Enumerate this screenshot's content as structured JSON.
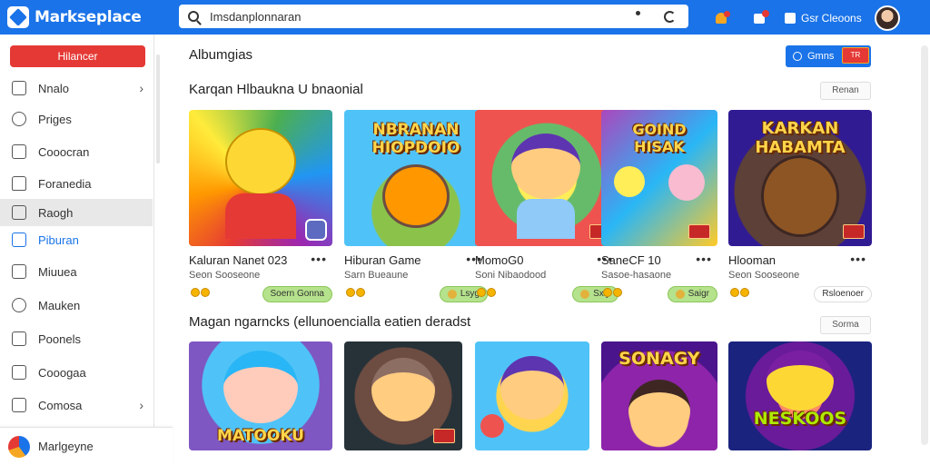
{
  "app": {
    "name": "Markseplace"
  },
  "search": {
    "value": "Imsdanplonnaran"
  },
  "user": {
    "label": "Gsr Cleoons"
  },
  "sidebar": {
    "top_button": "Hilancer",
    "items": [
      {
        "label": "Nnalo",
        "icon": "sparkle-icon",
        "chevron": "›"
      },
      {
        "label": "Priges",
        "icon": "drop-icon"
      },
      {
        "label": "Cooocran",
        "icon": "chat-icon"
      },
      {
        "label": "Foranedia",
        "icon": "home-icon"
      },
      {
        "label": "Raogh",
        "icon": "folder-icon",
        "selected": true
      },
      {
        "label": "Piburan",
        "icon": "window-icon",
        "active": true
      },
      {
        "label": "Miuuea",
        "icon": "pen-icon"
      },
      {
        "label": "Mauken",
        "icon": "target-icon"
      },
      {
        "label": "Poonels",
        "icon": "puzzle-icon"
      },
      {
        "label": "Cooogaa",
        "icon": "doc-icon"
      },
      {
        "label": "Comosa",
        "icon": "list-icon",
        "chevron": "›"
      }
    ],
    "footer": "Marlgeyne"
  },
  "main": {
    "title": "Albumgias",
    "header_button": {
      "label": "Gmns",
      "badge": "TR"
    },
    "sections": [
      {
        "title": "Karqan Hlbaukna U bnaonial",
        "more": "Renan",
        "cards": [
          {
            "title": "Kaluran Nanet 023",
            "sub": "Seon Sooseone",
            "tag": "Soern Gonna"
          },
          {
            "title": "Hiburan Game",
            "sub": "Sarn Bueaune",
            "tag": "Lsyg"
          },
          {
            "title": "MomoG0",
            "sub": "Soni Nibaodood",
            "tag": "Sxiy"
          },
          {
            "title": "SaneCF 10",
            "sub": "Sasoe-hasaone",
            "tag": "Saigr"
          },
          {
            "title": "Hlooman",
            "sub": "Seon Sooseone",
            "tag": "Rsloenoer"
          }
        ]
      },
      {
        "title": "Magan ngarncks  (ellunoencialla eatien deradst",
        "more": "Sorma",
        "cards": [
          {
            "overlay": "MATOOKU"
          },
          {
            "overlay": ""
          },
          {
            "overlay": ""
          },
          {
            "overlay": "SONAGY"
          },
          {
            "overlay": "NESKOOS"
          }
        ]
      }
    ],
    "row1_overlays": [
      "",
      "NBRANAN HIOPDOIO",
      "",
      "GOIND HISAK",
      "KARKAN HABAMTA"
    ]
  },
  "colors": {
    "accent": "#1a73e8",
    "danger": "#e53935",
    "tag_green": "#b5e28c"
  }
}
